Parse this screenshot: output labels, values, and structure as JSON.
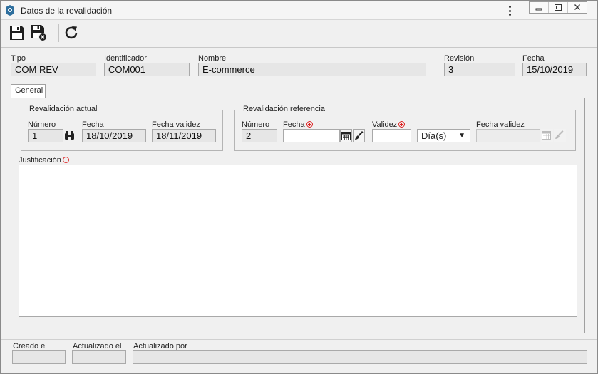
{
  "window": {
    "title": "Datos de la revalidación"
  },
  "header": {
    "tipo": {
      "label": "Tipo",
      "value": "COM REV"
    },
    "identificador": {
      "label": "Identificador",
      "value": "COM001"
    },
    "nombre": {
      "label": "Nombre",
      "value": "E-commerce"
    },
    "revision": {
      "label": "Revisión",
      "value": "3"
    },
    "fecha": {
      "label": "Fecha",
      "value": "15/10/2019"
    }
  },
  "tabs": [
    {
      "label": "General"
    }
  ],
  "revalidacion_actual": {
    "title": "Revalidación actual",
    "numero": {
      "label": "Número",
      "value": "1"
    },
    "fecha": {
      "label": "Fecha",
      "value": "18/10/2019"
    },
    "fecha_validez": {
      "label": "Fecha validez",
      "value": "18/11/2019"
    }
  },
  "revalidacion_referencia": {
    "title": "Revalidación referencia",
    "numero": {
      "label": "Número",
      "value": "2"
    },
    "fecha": {
      "label": "Fecha",
      "value": ""
    },
    "validez": {
      "label": "Validez",
      "value": ""
    },
    "unidad": {
      "selected": "Día(s)"
    },
    "fecha_validez": {
      "label": "Fecha validez",
      "value": ""
    }
  },
  "justificacion": {
    "label": "Justificación",
    "value": ""
  },
  "footer": {
    "creado_el": {
      "label": "Creado el",
      "value": ""
    },
    "actualizado_el": {
      "label": "Actualizado el",
      "value": ""
    },
    "actualizado_por": {
      "label": "Actualizado por",
      "value": ""
    }
  },
  "colors": {
    "required": "#dd2222",
    "app_icon": "#2e6f9e"
  },
  "icons": [
    "app-icon",
    "more-options-icon",
    "minimize-icon",
    "restore-icon",
    "close-icon",
    "save-icon",
    "save-and-close-icon",
    "refresh-icon",
    "search-binoculars-icon",
    "calendar-icon",
    "clear-brush-icon",
    "required-icon"
  ]
}
